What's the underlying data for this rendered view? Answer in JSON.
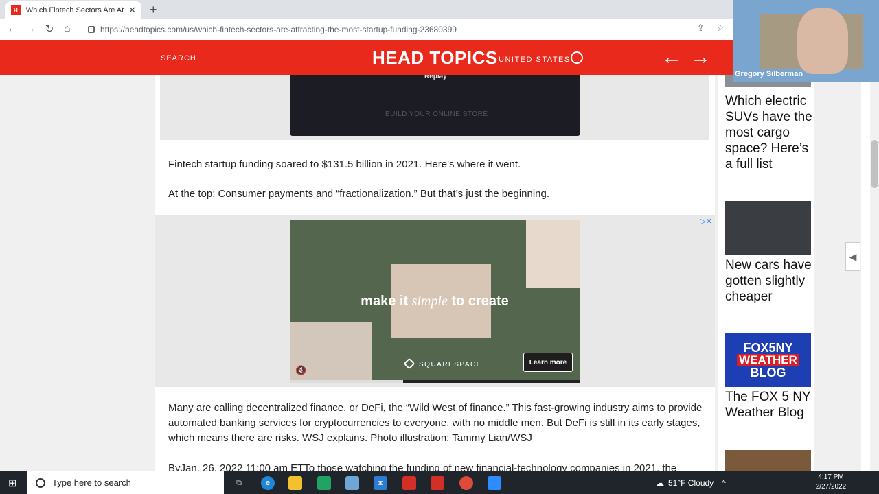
{
  "browser": {
    "tab_title": "Which Fintech Sectors Are Attrac",
    "url": "https://headtopics.com/us/which-fintech-sectors-are-attracting-the-most-startup-funding-23680399"
  },
  "header": {
    "search_label": "SEARCH",
    "logo": "HEAD TOPICS",
    "region": "UNITED STATES"
  },
  "video": {
    "replay_label": "Replay",
    "build_store_label": "BUILD YOUR ONLINE STORE"
  },
  "article": {
    "para1": "Fintech startup funding soared to $131.5 billion in 2021. Here's where it went.",
    "para2": "At the top: Consumer payments and “fractionalization.” But that’s just the beginning.",
    "para3": "Many are calling decentralized finance, or DeFi, the “Wild West of finance.” This fast-growing industry aims to provide automated banking services for cryptocurrencies to everyone, with no middle men. But DeFi is still in its early stages, which means there are risks. WSJ explains. Photo illustration: Tammy Lian/WSJ",
    "para4": "ByJan. 26, 2022 11:00 am ETTo those watching the funding of new financial-technology companies in 2021, the"
  },
  "ad": {
    "headline_before": "make it ",
    "headline_em": "simple",
    "headline_after": " to create",
    "brand": "SQUARESPACE",
    "cta": "Learn more",
    "progress_fraction": 0.39
  },
  "sidebar": {
    "cards": [
      {
        "title": "Which electric SUVs have the most cargo space? Here’s a full list"
      },
      {
        "title": "New cars have gotten slightly cheaper"
      },
      {
        "title": "The FOX 5 NY Weather Blog",
        "logo_l1": "FOX5NY",
        "logo_l2": "WEATHER",
        "logo_l3": "BLOG"
      }
    ]
  },
  "webcam": {
    "name": "Gregory Silberman"
  },
  "taskbar": {
    "search_placeholder": "Type here to search",
    "weather": "51°F  Cloudy",
    "time": "4:17 PM",
    "date": "2/27/2022"
  },
  "colors": {
    "brand_red": "#e8291c",
    "ad_green": "#55664f",
    "fox_blue": "#1e3fb4"
  }
}
